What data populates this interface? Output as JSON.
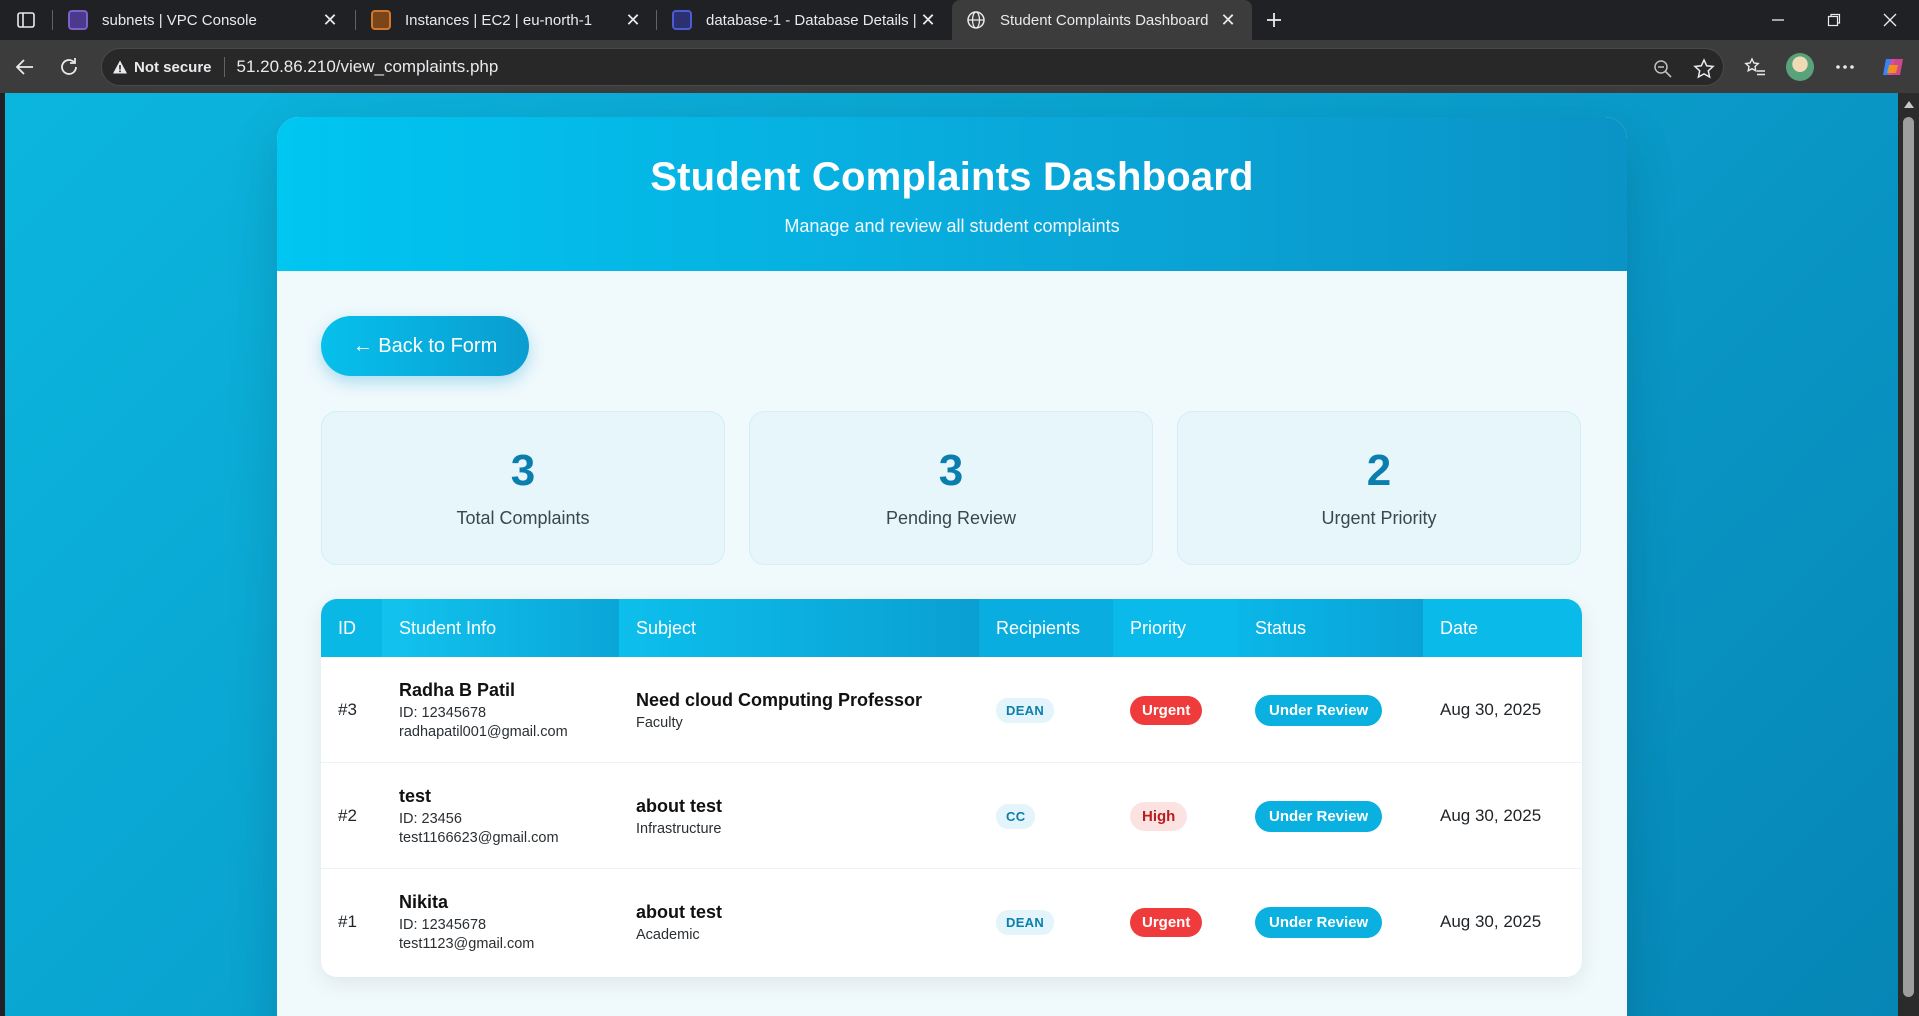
{
  "browser": {
    "tabs": [
      {
        "title": "subnets | VPC Console",
        "favicon_color": "#7b61c9"
      },
      {
        "title": "Instances | EC2 | eu-north-1",
        "favicon_color": "#d4772b"
      },
      {
        "title": "database-1 - Database Details | A",
        "favicon_color": "#4b5bd6"
      },
      {
        "title": "Student Complaints Dashboard",
        "favicon_color": "#e8eaed"
      }
    ],
    "omnibox": {
      "security_label": "Not secure",
      "url": "51.20.86.210/view_complaints.php"
    }
  },
  "page": {
    "title": "Student Complaints Dashboard",
    "subtitle": "Manage and review all student complaints",
    "back_label": "← Back to Form",
    "stats": [
      {
        "value": "3",
        "label": "Total Complaints"
      },
      {
        "value": "3",
        "label": "Pending Review"
      },
      {
        "value": "2",
        "label": "Urgent Priority"
      }
    ],
    "table": {
      "headers": [
        "ID",
        "Student Info",
        "Subject",
        "Recipients",
        "Priority",
        "Status",
        "Date"
      ],
      "rows": [
        {
          "id": "#3",
          "name": "Radha B Patil",
          "student_id": "ID: 12345678",
          "email": "radhapatil001@gmail.com",
          "subject": "Need cloud Computing Professor",
          "category": "Faculty",
          "recipient": "DEAN",
          "priority": "Urgent",
          "status": "Under Review",
          "date": "Aug 30, 2025"
        },
        {
          "id": "#2",
          "name": "test",
          "student_id": "ID: 23456",
          "email": "test1166623@gmail.com",
          "subject": "about test",
          "category": "Infrastructure",
          "recipient": "CC",
          "priority": "High",
          "status": "Under Review",
          "date": "Aug 30, 2025"
        },
        {
          "id": "#1",
          "name": "Nikita",
          "student_id": "ID: 12345678",
          "email": "test1123@gmail.com",
          "subject": "about test",
          "category": "Academic",
          "recipient": "DEAN",
          "priority": "Urgent",
          "status": "Under Review",
          "date": "Aug 30, 2025"
        }
      ]
    }
  },
  "colors": {
    "accent": "#0ab0df",
    "urgent": "#ef3b3b",
    "high_bg": "#fde2e2",
    "stat_number": "#0a7fae"
  }
}
